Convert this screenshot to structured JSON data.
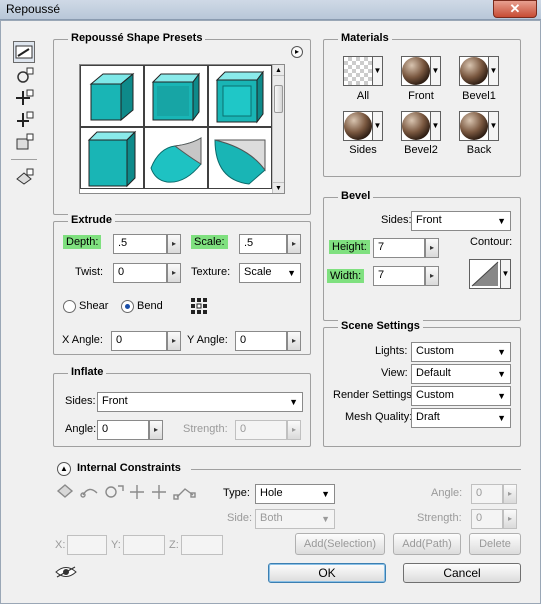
{
  "window": {
    "title": "Repoussé",
    "close_glyph": "✕"
  },
  "presets": {
    "title": "Repoussé Shape Presets",
    "menu_glyph": "▸"
  },
  "materials": {
    "title": "Materials",
    "items": [
      {
        "label": "All"
      },
      {
        "label": "Front"
      },
      {
        "label": "Bevel1"
      },
      {
        "label": "Sides"
      },
      {
        "label": "Bevel2"
      },
      {
        "label": "Back"
      }
    ]
  },
  "extrude": {
    "title": "Extrude",
    "depth_label": "Depth:",
    "depth_value": ".5",
    "scale_label": "Scale:",
    "scale_value": ".5",
    "twist_label": "Twist:",
    "twist_value": "0",
    "texture_label": "Texture:",
    "texture_value": "Scale",
    "shear_label": "Shear",
    "bend_label": "Bend",
    "xangle_label": "X Angle:",
    "xangle_value": "0",
    "yangle_label": "Y Angle:",
    "yangle_value": "0"
  },
  "bevel": {
    "title": "Bevel",
    "sides_label": "Sides:",
    "sides_value": "Front",
    "height_label": "Height:",
    "height_value": "7",
    "width_label": "Width:",
    "width_value": "7",
    "contour_label": "Contour:"
  },
  "scene": {
    "title": "Scene Settings",
    "lights_label": "Lights:",
    "lights_value": "Custom",
    "view_label": "View:",
    "view_value": "Default",
    "render_label": "Render Settings:",
    "render_value": "Custom",
    "mesh_label": "Mesh Quality:",
    "mesh_value": "Draft"
  },
  "inflate": {
    "title": "Inflate",
    "sides_label": "Sides:",
    "sides_value": "Front",
    "angle_label": "Angle:",
    "angle_value": "0",
    "strength_label": "Strength:",
    "strength_value": "0"
  },
  "constraints": {
    "title": "Internal Constraints",
    "type_label": "Type:",
    "type_value": "Hole",
    "side_label": "Side:",
    "side_value": "Both",
    "angle_label": "Angle:",
    "angle_value": "0",
    "strength_label": "Strength:",
    "strength_value": "0",
    "x_label": "X:",
    "y_label": "Y:",
    "z_label": "Z:",
    "add_selection": "Add(Selection)",
    "add_path": "Add(Path)",
    "delete": "Delete"
  },
  "buttons": {
    "ok": "OK",
    "cancel": "Cancel"
  }
}
